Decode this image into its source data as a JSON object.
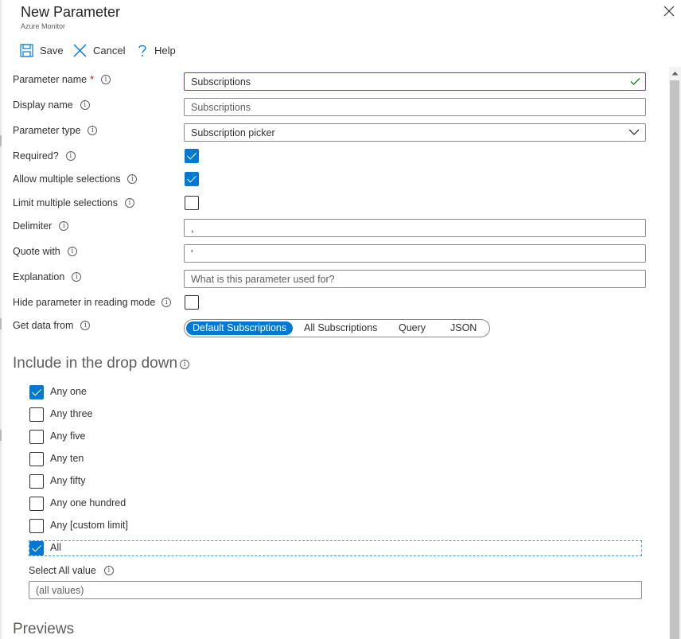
{
  "header": {
    "title": "New Parameter",
    "subtitle": "Azure Monitor"
  },
  "toolbar": {
    "save_label": "Save",
    "cancel_label": "Cancel",
    "help_label": "Help"
  },
  "form": {
    "parameter_name": {
      "label": "Parameter name",
      "required_mark": "*",
      "value": "Subscriptions"
    },
    "display_name": {
      "label": "Display name",
      "placeholder": "Subscriptions"
    },
    "parameter_type": {
      "label": "Parameter type",
      "value": "Subscription picker"
    },
    "required": {
      "label": "Required?",
      "checked": true
    },
    "allow_multiple": {
      "label": "Allow multiple selections",
      "checked": true
    },
    "limit_multiple": {
      "label": "Limit multiple selections",
      "checked": false
    },
    "delimiter": {
      "label": "Delimiter",
      "value": ","
    },
    "quote_with": {
      "label": "Quote with",
      "value": "'"
    },
    "explanation": {
      "label": "Explanation",
      "placeholder": "What is this parameter used for?"
    },
    "hide_reading": {
      "label": "Hide parameter in reading mode",
      "checked": false
    },
    "get_data_from": {
      "label": "Get data from",
      "options": [
        "Default Subscriptions",
        "All Subscriptions",
        "Query",
        "JSON"
      ],
      "selected": "Default Subscriptions"
    }
  },
  "dropdown_section": {
    "title": "Include in the drop down",
    "items": [
      {
        "label": "Any one",
        "checked": true
      },
      {
        "label": "Any three",
        "checked": false
      },
      {
        "label": "Any five",
        "checked": false
      },
      {
        "label": "Any ten",
        "checked": false
      },
      {
        "label": "Any fifty",
        "checked": false
      },
      {
        "label": "Any one hundred",
        "checked": false
      },
      {
        "label": "Any [custom limit]",
        "checked": false
      },
      {
        "label": "All",
        "checked": true
      }
    ],
    "select_all_label": "Select All value",
    "select_all_placeholder": "(all values)"
  },
  "previews_title": "Previews",
  "info_glyph": "i",
  "colors": {
    "accent": "#0078d4",
    "focus_border": "#8a2ba0",
    "required": "#a4262c",
    "valid": "#107c10"
  }
}
